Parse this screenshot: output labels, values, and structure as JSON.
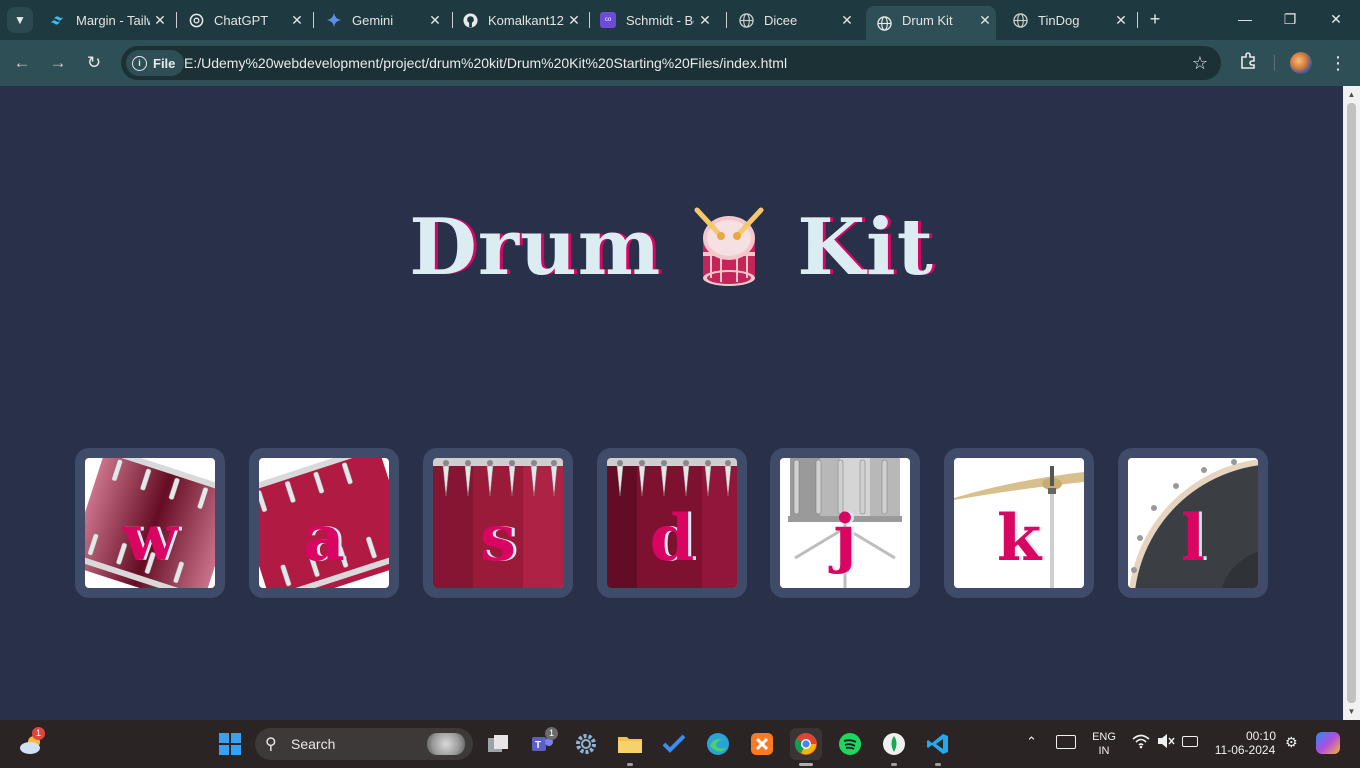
{
  "browser": {
    "tabs": [
      {
        "title": "Margin - Tailwind CSS",
        "icon": "tailwind-icon"
      },
      {
        "title": "ChatGPT",
        "icon": "chatgpt-icon"
      },
      {
        "title": "Gemini",
        "icon": "gemini-icon"
      },
      {
        "title": "Komalkant12",
        "icon": "github-icon"
      },
      {
        "title": "Schmidt - Be",
        "icon": "coolors-icon"
      },
      {
        "title": "Dicee",
        "icon": "globe-icon"
      },
      {
        "title": "Drum Kit",
        "icon": "globe-icon",
        "active": true
      },
      {
        "title": "TinDog",
        "icon": "globe-icon"
      }
    ],
    "chip_label": "File",
    "url": "E:/Udemy%20webdevelopment/project/drum%20kit/Drum%20Kit%20Starting%20Files/index.html"
  },
  "page": {
    "title_left": "Drum",
    "title_right": "Kit",
    "pads": [
      {
        "key": "w",
        "image": "tom-1"
      },
      {
        "key": "a",
        "image": "tom-2"
      },
      {
        "key": "s",
        "image": "tom-3"
      },
      {
        "key": "d",
        "image": "tom-4"
      },
      {
        "key": "j",
        "image": "snare"
      },
      {
        "key": "k",
        "image": "crash"
      },
      {
        "key": "l",
        "image": "kick"
      }
    ],
    "colors": {
      "background": "#283149",
      "pad_border": "#404b69",
      "title": "#dbedf3",
      "accent": "#da0463"
    }
  },
  "taskbar": {
    "weather_badge": "1",
    "search_label": "Search",
    "teams_badge": "1",
    "lang_top": "ENG",
    "lang_bottom": "IN",
    "time": "00:10",
    "date": "11-06-2024"
  }
}
